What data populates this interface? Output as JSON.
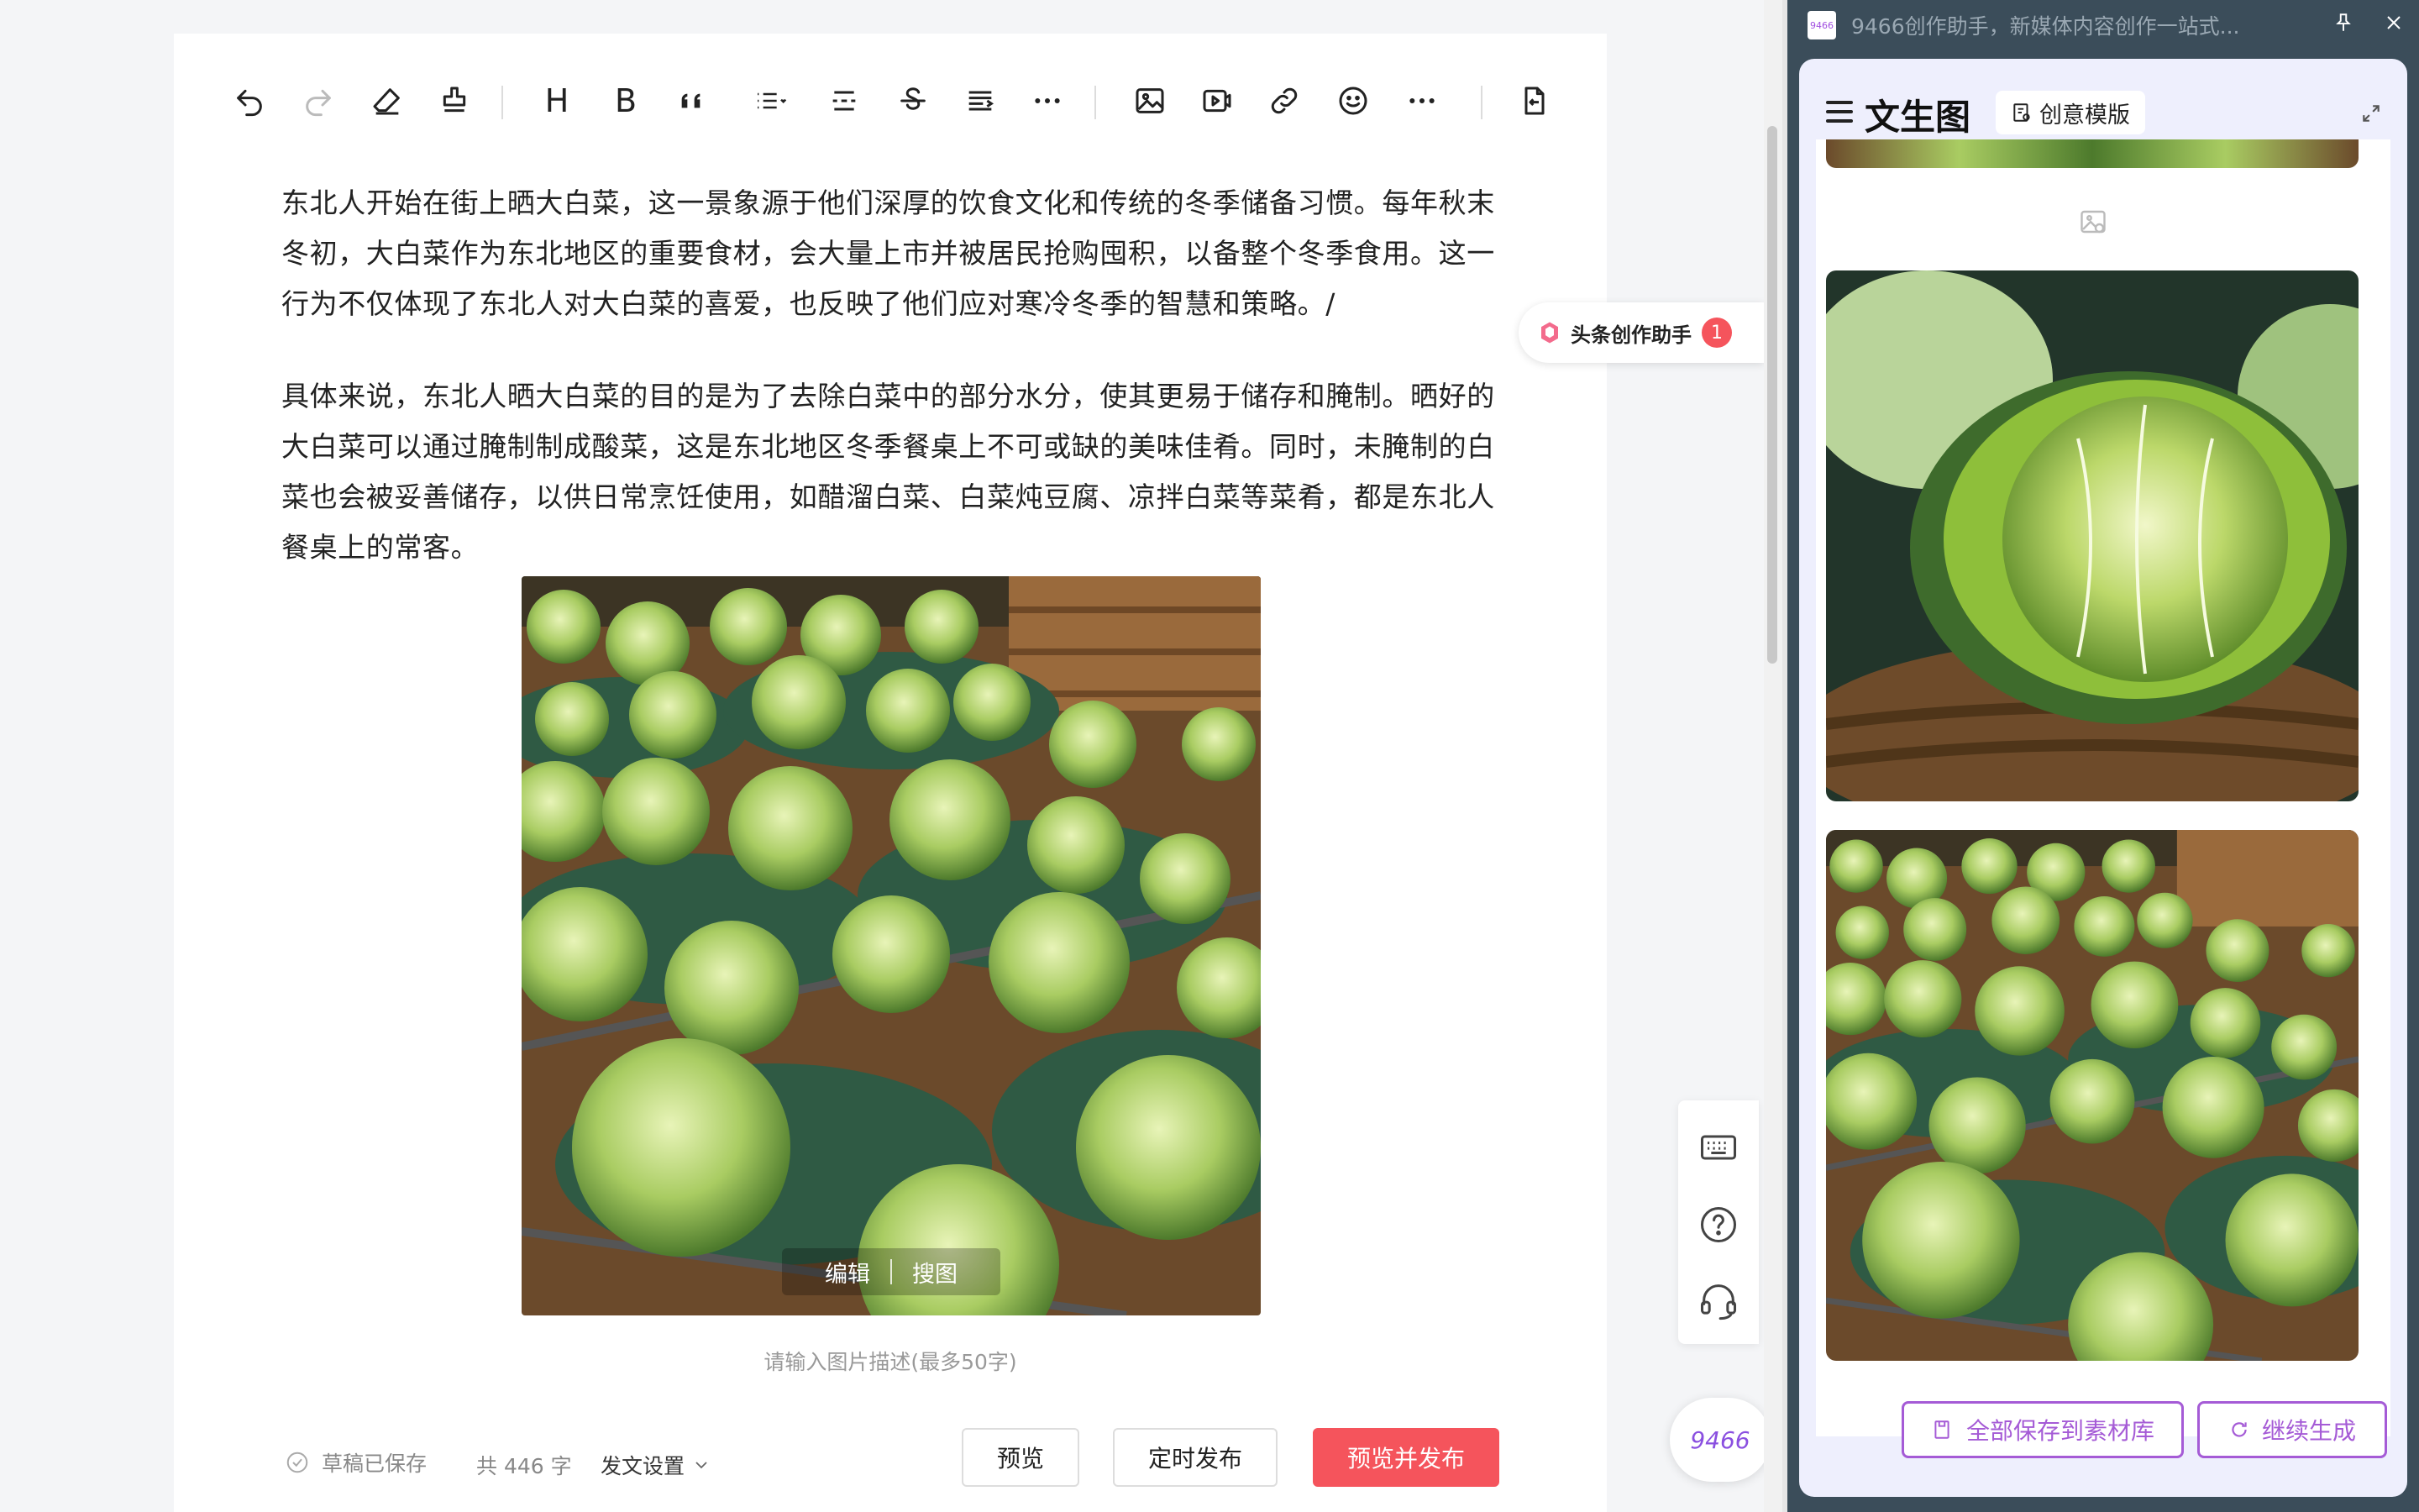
{
  "toolbar": {
    "items": [
      "undo-icon",
      "redo-icon",
      "eraser-icon",
      "format-painter-icon",
      "heading-icon",
      "bold-icon",
      "quote-icon",
      "list-icon",
      "divider-icon",
      "strikethrough-icon",
      "align-icon",
      "more-icon",
      "image-icon",
      "video-icon",
      "link-icon",
      "emoji-icon",
      "more-icon-2",
      "import-doc-icon"
    ],
    "heading_label": "H",
    "bold_label": "B"
  },
  "article": {
    "paragraph_1": "东北人开始在街上晒大白菜，这一景象源于他们深厚的饮食文化和传统的冬季储备习惯。每年秋末冬初，大白菜作为东北地区的重要食材，会大量上市并被居民抢购囤积，以备整个冬季食用。这一行为不仅体现了东北人对大白菜的喜爱，也反映了他们应对寒冷冬季的智慧和策略。/",
    "paragraph_2": "具体来说，东北人晒大白菜的目的是为了去除白菜中的部分水分，使其更易于储存和腌制。晒好的大白菜可以通过腌制制成酸菜，这是东北地区冬季餐桌上不可或缺的美味佳肴。同时，未腌制的白菜也会被妥善储存，以供日常烹饪使用，如醋溜白菜、白菜炖豆腐、凉拌白菜等菜肴，都是东北人餐桌上的常客。",
    "image_actions": {
      "edit": "编辑",
      "search": "搜图"
    },
    "image_caption_placeholder": "请输入图片描述(最多50字)"
  },
  "bottom_bar": {
    "draft_status": "草稿已保存",
    "word_count": "共 446 字",
    "publish_settings": "发文设置",
    "preview": "预览",
    "schedule": "定时发布",
    "preview_publish": "预览并发布"
  },
  "floating": {
    "assistant_label": "头条创作助手",
    "assistant_badge": "1",
    "tools": [
      "keyboard-icon",
      "help-icon",
      "headset-icon"
    ],
    "logo_text": "9466"
  },
  "side_window": {
    "app_logo": "9466",
    "title": "9466创作助手，新媒体内容创作一站式...",
    "panel_title": "文生图",
    "template_button": "创意模版",
    "save_all": "全部保存到素材库",
    "continue": "继续生成"
  },
  "colors": {
    "primary_red": "#f5545c",
    "purple_accent": "#a55bd6",
    "side_bg": "#3b4d5a",
    "panel_bg": "#eeeffd"
  }
}
